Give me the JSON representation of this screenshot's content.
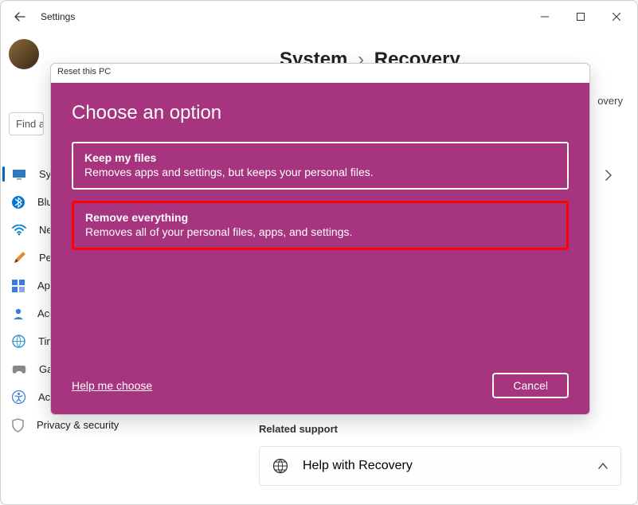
{
  "titlebar": {
    "app_title": "Settings"
  },
  "breadcrumb": {
    "parent": "System",
    "current": "Recovery"
  },
  "search": {
    "placeholder": "Find a setting"
  },
  "sidebar_peek": {
    "overflow_text": "overy"
  },
  "nav": {
    "items": [
      {
        "label": "System"
      },
      {
        "label": "Bluetooth & devices"
      },
      {
        "label": "Network & internet"
      },
      {
        "label": "Personalization"
      },
      {
        "label": "Apps"
      },
      {
        "label": "Accounts"
      },
      {
        "label": "Time & language"
      },
      {
        "label": "Gaming"
      },
      {
        "label": "Accessibility"
      },
      {
        "label": "Privacy & security"
      }
    ]
  },
  "related": {
    "heading": "Related support",
    "help_label": "Help with Recovery"
  },
  "modal": {
    "window_title": "Reset this PC",
    "heading": "Choose an option",
    "options": [
      {
        "title": "Keep my files",
        "desc": "Removes apps and settings, but keeps your personal files."
      },
      {
        "title": "Remove everything",
        "desc": "Removes all of your personal files, apps, and settings."
      }
    ],
    "help_link": "Help me choose",
    "cancel": "Cancel"
  }
}
